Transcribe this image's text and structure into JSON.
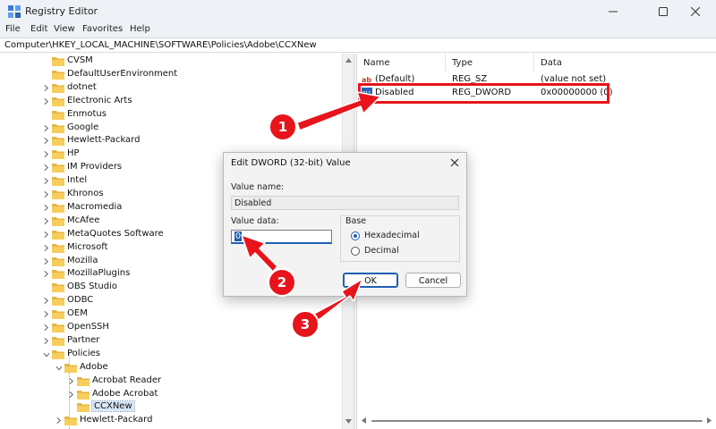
{
  "window": {
    "title": "Registry Editor",
    "controls": [
      "minimize-icon",
      "maximize-icon",
      "close-icon"
    ]
  },
  "menu": [
    "File",
    "Edit",
    "View",
    "Favorites",
    "Help"
  ],
  "address": "Computer\\HKEY_LOCAL_MACHINE\\SOFTWARE\\Policies\\Adobe\\CCXNew",
  "tree": [
    {
      "label": "CVSM",
      "expander": false,
      "indent": 0
    },
    {
      "label": "DefaultUserEnvironment",
      "expander": false,
      "indent": 0
    },
    {
      "label": "dotnet",
      "expander": true,
      "indent": 0
    },
    {
      "label": "Electronic Arts",
      "expander": true,
      "indent": 0
    },
    {
      "label": "Enmotus",
      "expander": false,
      "indent": 0
    },
    {
      "label": "Google",
      "expander": true,
      "indent": 0
    },
    {
      "label": "Hewlett-Packard",
      "expander": true,
      "indent": 0
    },
    {
      "label": "HP",
      "expander": true,
      "indent": 0
    },
    {
      "label": "IM Providers",
      "expander": true,
      "indent": 0
    },
    {
      "label": "Intel",
      "expander": true,
      "indent": 0
    },
    {
      "label": "Khronos",
      "expander": true,
      "indent": 0
    },
    {
      "label": "Macromedia",
      "expander": true,
      "indent": 0
    },
    {
      "label": "McAfee",
      "expander": true,
      "indent": 0
    },
    {
      "label": "MetaQuotes Software",
      "expander": true,
      "indent": 0
    },
    {
      "label": "Microsoft",
      "expander": true,
      "indent": 0
    },
    {
      "label": "Mozilla",
      "expander": true,
      "indent": 0
    },
    {
      "label": "MozillaPlugins",
      "expander": true,
      "indent": 0
    },
    {
      "label": "OBS Studio",
      "expander": false,
      "indent": 0
    },
    {
      "label": "ODBC",
      "expander": true,
      "indent": 0
    },
    {
      "label": "OEM",
      "expander": true,
      "indent": 0
    },
    {
      "label": "OpenSSH",
      "expander": true,
      "indent": 0
    },
    {
      "label": "Partner",
      "expander": true,
      "indent": 0
    },
    {
      "label": "Policies",
      "expander": "open",
      "indent": 0
    },
    {
      "label": "Adobe",
      "expander": "open",
      "indent": 1
    },
    {
      "label": "Acrobat Reader",
      "expander": true,
      "indent": 2
    },
    {
      "label": "Adobe Acrobat",
      "expander": true,
      "indent": 2
    },
    {
      "label": "CCXNew",
      "expander": false,
      "indent": 2,
      "selected": true
    },
    {
      "label": "Hewlett-Packard",
      "expander": true,
      "indent": 1
    }
  ],
  "values_header": {
    "name": "Name",
    "type": "Type",
    "data": "Data"
  },
  "values": [
    {
      "icon": "string-value-icon",
      "name": "(Default)",
      "type": "REG_SZ",
      "data": "(value not set)"
    },
    {
      "icon": "binary-value-icon",
      "name": "Disabled",
      "type": "REG_DWORD",
      "data": "0x00000000 (0)"
    }
  ],
  "dialog": {
    "title": "Edit DWORD (32-bit) Value",
    "value_name_label": "Value name:",
    "value_name": "Disabled",
    "value_data_label": "Value data:",
    "value_data": "0",
    "base_label": "Base",
    "hex_label": "Hexadecimal",
    "dec_label": "Decimal",
    "base_selected": "Hexadecimal",
    "ok_label": "OK",
    "cancel_label": "Cancel"
  },
  "annotations": {
    "color": "#e8141b",
    "steps": [
      "1",
      "2",
      "3"
    ]
  }
}
